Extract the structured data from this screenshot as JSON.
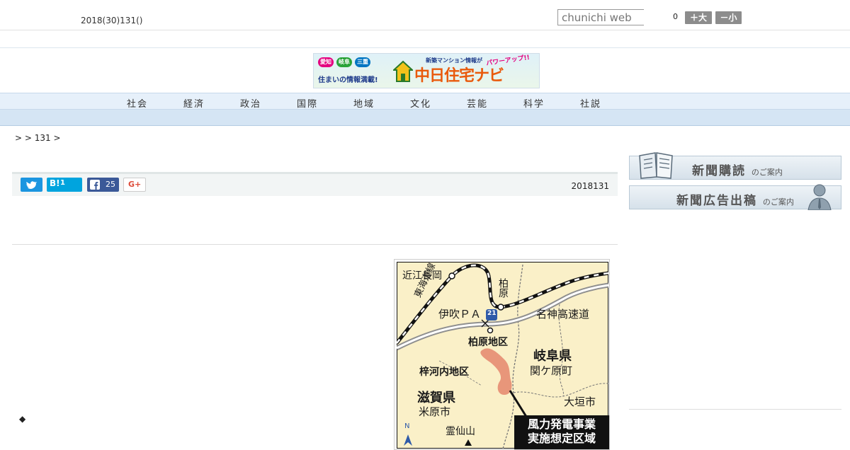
{
  "header": {
    "date": "2018(30)131()",
    "search_placeholder": "chunichi web",
    "font_size_count": "0",
    "font_large_label": "＋大",
    "font_small_label": "－小"
  },
  "banner": {
    "pill_1": "愛知",
    "pill_2": "岐阜",
    "pill_3": "三重",
    "left_text": "住まいの情報満載!",
    "top_text": "新築マンション情報が",
    "power_text": "パワーアップ!!",
    "title": "中日住宅ナビ"
  },
  "nav": {
    "items": [
      "社会",
      "経済",
      "政治",
      "国際",
      "地域",
      "文化",
      "芸能",
      "科学",
      "社説"
    ]
  },
  "breadcrumb": {
    "text": ">  > 131 >"
  },
  "share": {
    "hatena_count": "1",
    "facebook_count": "25",
    "gplus_label": "G+",
    "pubdate": "2018131"
  },
  "article": {
    "bullet": "◆"
  },
  "map": {
    "labels": {
      "omi_nagaoka": "近江長岡",
      "kashiwabara_station": "柏原",
      "tokaido_line": "東海道線",
      "ibuki_pa": "伊吹ＰＡ",
      "route_21": "21",
      "meishin": "名神高速道",
      "kashiwabara_district": "柏原地区",
      "gifu_pref": "岐阜県",
      "sekigahara": "関ケ原町",
      "azusakawachi": "梓河内地区",
      "shiga_pref": "滋賀県",
      "maibara": "米原市",
      "ogaki": "大垣市",
      "ryozen": "霊仙山",
      "north": "N",
      "area_line1": "風力発電事業",
      "area_line2": "実施想定区域"
    },
    "colors": {
      "land": "#faf0c8",
      "wind_area": "#e8967a",
      "rail": "#111111",
      "highway": "#8f8f8f"
    }
  },
  "sidebar": {
    "subscribe_title": "新聞購読",
    "subscribe_sub": "のご案内",
    "ad_title": "新聞広告出稿",
    "ad_sub": "のご案内"
  }
}
